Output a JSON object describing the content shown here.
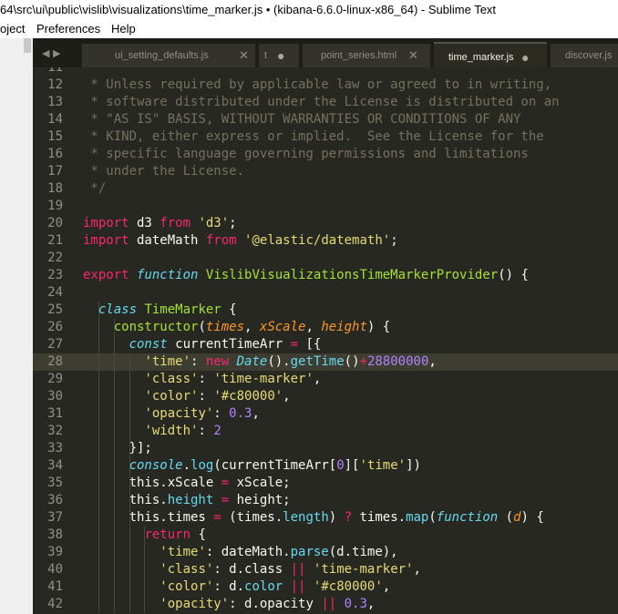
{
  "window": {
    "title": "64\\src\\ui\\public\\vislib\\visualizations\\time_marker.js • (kibana-6.6.0-linux-x86_64) - Sublime Text"
  },
  "menu": {
    "items": [
      {
        "label": "oject"
      },
      {
        "label": "Preferences"
      },
      {
        "label": "Help"
      }
    ]
  },
  "tabs": [
    {
      "label": "ui_setting_defaults.js",
      "state": "close"
    },
    {
      "label": "t",
      "state": "dirty"
    },
    {
      "label": "point_series.html",
      "state": "close"
    },
    {
      "label": "time_marker.js",
      "state": "dirty",
      "active": true
    },
    {
      "label": "discover.js",
      "state": "none"
    }
  ],
  "editor": {
    "highlighted_line": 28,
    "lines": [
      {
        "n": "11",
        "t": [
          [
            "c-comment",
            ""
          ]
        ]
      },
      {
        "n": "12",
        "t": [
          [
            "c-comment",
            " * Unless required by applicable law or agreed to in writing,"
          ]
        ]
      },
      {
        "n": "13",
        "t": [
          [
            "c-comment",
            " * software distributed under the License is distributed on an"
          ]
        ]
      },
      {
        "n": "14",
        "t": [
          [
            "c-comment",
            " * \"AS IS\" BASIS, WITHOUT WARRANTIES OR CONDITIONS OF ANY"
          ]
        ]
      },
      {
        "n": "15",
        "t": [
          [
            "c-comment",
            " * KIND, either express or implied.  See the License for the"
          ]
        ]
      },
      {
        "n": "16",
        "t": [
          [
            "c-comment",
            " * specific language governing permissions and limitations"
          ]
        ]
      },
      {
        "n": "17",
        "t": [
          [
            "c-comment",
            " * under the License."
          ]
        ]
      },
      {
        "n": "18",
        "t": [
          [
            "c-comment",
            " */"
          ]
        ]
      },
      {
        "n": "19",
        "t": []
      },
      {
        "n": "20",
        "t": [
          [
            "c-kw",
            "import"
          ],
          [
            "c-plain",
            " d3 "
          ],
          [
            "c-kw",
            "from"
          ],
          [
            "c-plain",
            " "
          ],
          [
            "c-str",
            "'d3'"
          ],
          [
            "c-plain",
            ";"
          ]
        ]
      },
      {
        "n": "21",
        "t": [
          [
            "c-kw",
            "import"
          ],
          [
            "c-plain",
            " dateMath "
          ],
          [
            "c-kw",
            "from"
          ],
          [
            "c-plain",
            " "
          ],
          [
            "c-str",
            "'@elastic/datemath'"
          ],
          [
            "c-plain",
            ";"
          ]
        ]
      },
      {
        "n": "22",
        "t": []
      },
      {
        "n": "23",
        "t": [
          [
            "c-kw",
            "export"
          ],
          [
            "c-plain",
            " "
          ],
          [
            "c-it",
            "function"
          ],
          [
            "c-plain",
            " "
          ],
          [
            "c-fn",
            "VislibVisualizationsTimeMarkerProvider"
          ],
          [
            "c-plain",
            "() {"
          ]
        ]
      },
      {
        "n": "24",
        "t": []
      },
      {
        "n": "25",
        "t": [
          [
            "c-plain",
            "  "
          ],
          [
            "c-it",
            "class"
          ],
          [
            "c-plain",
            " "
          ],
          [
            "c-class",
            "TimeMarker"
          ],
          [
            "c-plain",
            " {"
          ]
        ]
      },
      {
        "n": "26",
        "t": [
          [
            "c-plain",
            "    "
          ],
          [
            "c-fn",
            "constructor"
          ],
          [
            "c-plain",
            "("
          ],
          [
            "c-param",
            "times"
          ],
          [
            "c-plain",
            ", "
          ],
          [
            "c-param",
            "xScale"
          ],
          [
            "c-plain",
            ", "
          ],
          [
            "c-param",
            "height"
          ],
          [
            "c-plain",
            ") {"
          ]
        ]
      },
      {
        "n": "27",
        "t": [
          [
            "c-plain",
            "      "
          ],
          [
            "c-it",
            "const"
          ],
          [
            "c-plain",
            " currentTimeArr "
          ],
          [
            "c-kw",
            "="
          ],
          [
            "c-plain",
            " [{"
          ]
        ]
      },
      {
        "n": "28",
        "t": [
          [
            "c-plain",
            "        "
          ],
          [
            "c-str",
            "'time'"
          ],
          [
            "c-plain",
            ": "
          ],
          [
            "c-kw",
            "new"
          ],
          [
            "c-plain",
            " "
          ],
          [
            "c-it",
            "Date"
          ],
          [
            "c-plain",
            "()."
          ],
          [
            "c-blue",
            "getTime"
          ],
          [
            "c-plain",
            "()"
          ],
          [
            "c-kw",
            "+"
          ],
          [
            "c-num",
            "28800000"
          ],
          [
            "c-plain",
            ","
          ]
        ]
      },
      {
        "n": "29",
        "t": [
          [
            "c-plain",
            "        "
          ],
          [
            "c-str",
            "'class'"
          ],
          [
            "c-plain",
            ": "
          ],
          [
            "c-str",
            "'time-marker'"
          ],
          [
            "c-plain",
            ","
          ]
        ]
      },
      {
        "n": "30",
        "t": [
          [
            "c-plain",
            "        "
          ],
          [
            "c-str",
            "'color'"
          ],
          [
            "c-plain",
            ": "
          ],
          [
            "c-str",
            "'#c80000'"
          ],
          [
            "c-plain",
            ","
          ]
        ]
      },
      {
        "n": "31",
        "t": [
          [
            "c-plain",
            "        "
          ],
          [
            "c-str",
            "'opacity'"
          ],
          [
            "c-plain",
            ": "
          ],
          [
            "c-num",
            "0.3"
          ],
          [
            "c-plain",
            ","
          ]
        ]
      },
      {
        "n": "32",
        "t": [
          [
            "c-plain",
            "        "
          ],
          [
            "c-str",
            "'width'"
          ],
          [
            "c-plain",
            ": "
          ],
          [
            "c-num",
            "2"
          ]
        ]
      },
      {
        "n": "33",
        "t": [
          [
            "c-plain",
            "      }];"
          ]
        ]
      },
      {
        "n": "34",
        "t": [
          [
            "c-plain",
            "      "
          ],
          [
            "c-it",
            "console"
          ],
          [
            "c-plain",
            "."
          ],
          [
            "c-blue",
            "log"
          ],
          [
            "c-plain",
            "(currentTimeArr["
          ],
          [
            "c-num",
            "0"
          ],
          [
            "c-plain",
            "]["
          ],
          [
            "c-str",
            "'time'"
          ],
          [
            "c-plain",
            "])"
          ]
        ]
      },
      {
        "n": "35",
        "t": [
          [
            "c-plain",
            "      this.xScale "
          ],
          [
            "c-kw",
            "="
          ],
          [
            "c-plain",
            " xScale;"
          ]
        ]
      },
      {
        "n": "36",
        "t": [
          [
            "c-plain",
            "      this."
          ],
          [
            "c-blue",
            "height"
          ],
          [
            "c-plain",
            " "
          ],
          [
            "c-kw",
            "="
          ],
          [
            "c-plain",
            " height;"
          ]
        ]
      },
      {
        "n": "37",
        "t": [
          [
            "c-plain",
            "      this.times "
          ],
          [
            "c-kw",
            "="
          ],
          [
            "c-plain",
            " (times."
          ],
          [
            "c-blue",
            "length"
          ],
          [
            "c-plain",
            ") "
          ],
          [
            "c-kw",
            "?"
          ],
          [
            "c-plain",
            " times."
          ],
          [
            "c-blue",
            "map"
          ],
          [
            "c-plain",
            "("
          ],
          [
            "c-it",
            "function"
          ],
          [
            "c-plain",
            " ("
          ],
          [
            "c-param",
            "d"
          ],
          [
            "c-plain",
            ") {"
          ]
        ]
      },
      {
        "n": "38",
        "t": [
          [
            "c-plain",
            "        "
          ],
          [
            "c-kw",
            "return"
          ],
          [
            "c-plain",
            " {"
          ]
        ]
      },
      {
        "n": "39",
        "t": [
          [
            "c-plain",
            "          "
          ],
          [
            "c-str",
            "'time'"
          ],
          [
            "c-plain",
            ": dateMath."
          ],
          [
            "c-blue",
            "parse"
          ],
          [
            "c-plain",
            "(d.time),"
          ]
        ]
      },
      {
        "n": "40",
        "t": [
          [
            "c-plain",
            "          "
          ],
          [
            "c-str",
            "'class'"
          ],
          [
            "c-plain",
            ": d.class "
          ],
          [
            "c-kw",
            "||"
          ],
          [
            "c-plain",
            " "
          ],
          [
            "c-str",
            "'time-marker'"
          ],
          [
            "c-plain",
            ","
          ]
        ]
      },
      {
        "n": "41",
        "t": [
          [
            "c-plain",
            "          "
          ],
          [
            "c-str",
            "'color'"
          ],
          [
            "c-plain",
            ": d."
          ],
          [
            "c-blue",
            "color"
          ],
          [
            "c-plain",
            " "
          ],
          [
            "c-kw",
            "||"
          ],
          [
            "c-plain",
            " "
          ],
          [
            "c-str",
            "'#c80000'"
          ],
          [
            "c-plain",
            ","
          ]
        ]
      },
      {
        "n": "42",
        "t": [
          [
            "c-plain",
            "          "
          ],
          [
            "c-str",
            "'opacity'"
          ],
          [
            "c-plain",
            ": d.opacity "
          ],
          [
            "c-kw",
            "||"
          ],
          [
            "c-plain",
            " "
          ],
          [
            "c-num",
            "0.3"
          ],
          [
            "c-plain",
            ","
          ]
        ]
      }
    ]
  },
  "icons": {
    "tab_nav": "tab-nav-arrows-icon",
    "tab_close": "close-icon",
    "tab_dirty": "unsaved-dot-icon"
  },
  "colors": {
    "editor_bg": "#272822",
    "keyword": "#f92672",
    "string": "#e6db74",
    "function": "#a6e22e",
    "number": "#ae81ff",
    "comment": "#75715e"
  }
}
